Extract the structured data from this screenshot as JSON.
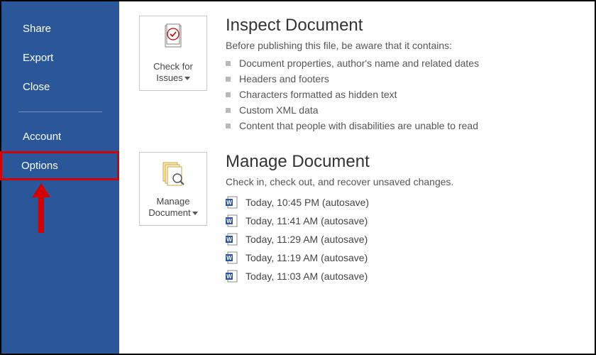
{
  "sidebar": {
    "items": [
      {
        "id": "share",
        "label": "Share"
      },
      {
        "id": "export",
        "label": "Export"
      },
      {
        "id": "close",
        "label": "Close"
      },
      {
        "id": "account",
        "label": "Account"
      },
      {
        "id": "options",
        "label": "Options"
      }
    ],
    "highlighted_index": 4
  },
  "inspect": {
    "button_label_line1": "Check for",
    "button_label_line2": "Issues",
    "title": "Inspect Document",
    "subtitle": "Before publishing this file, be aware that it contains:",
    "bullets": [
      "Document properties, author's name and related dates",
      "Headers and footers",
      "Characters formatted as hidden text",
      "Custom XML data",
      "Content that people with disabilities are unable to read"
    ]
  },
  "manage": {
    "button_label_line1": "Manage",
    "button_label_line2": "Document",
    "title": "Manage Document",
    "subtitle": "Check in, check out, and recover unsaved changes.",
    "versions": [
      "Today, 10:45 PM (autosave)",
      "Today, 11:41 AM (autosave)",
      "Today, 11:29 AM (autosave)",
      "Today, 11:19 AM (autosave)",
      "Today, 11:03 AM (autosave)"
    ]
  },
  "colors": {
    "sidebar_bg": "#2a579a",
    "highlight": "#d40000",
    "accent": "#2b579a"
  }
}
